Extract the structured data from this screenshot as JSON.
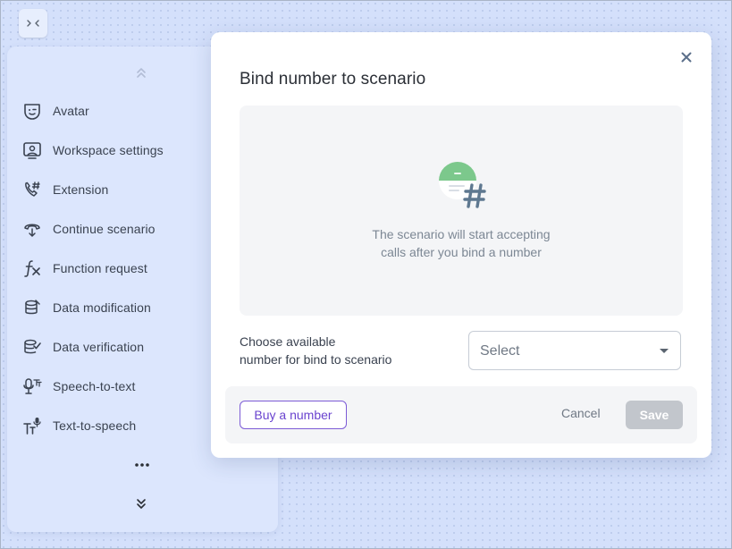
{
  "sidebar": {
    "collapse_icon": "collapse-arrows-icon",
    "items": [
      {
        "label": "Avatar",
        "icon": "avatar-icon"
      },
      {
        "label": "Workspace settings",
        "icon": "workspace-settings-icon"
      },
      {
        "label": "Extension",
        "icon": "extension-icon"
      },
      {
        "label": "Continue scenario",
        "icon": "continue-scenario-icon"
      },
      {
        "label": "Function request",
        "icon": "function-icon"
      },
      {
        "label": "Data modification",
        "icon": "data-modification-icon"
      },
      {
        "label": "Data verification",
        "icon": "data-verification-icon"
      },
      {
        "label": "Speech-to-text",
        "icon": "speech-to-text-icon"
      },
      {
        "label": "Text-to-speech",
        "icon": "text-to-speech-icon"
      }
    ]
  },
  "modal": {
    "title": "Bind number to scenario",
    "empty_line1": "The scenario will start accepting",
    "empty_line2": "calls after you bind a number",
    "choose_line1": "Choose available",
    "choose_line2": "number for bind to scenario",
    "select_placeholder": "Select",
    "buy_label": "Buy a number",
    "cancel_label": "Cancel",
    "save_label": "Save"
  },
  "colors": {
    "accent": "#6a44cf",
    "background": "#d4e0fb",
    "sidebar_bg": "#dce6fd",
    "disabled_button": "#c2c6cc",
    "empty_art_green": "#7cc88c"
  }
}
